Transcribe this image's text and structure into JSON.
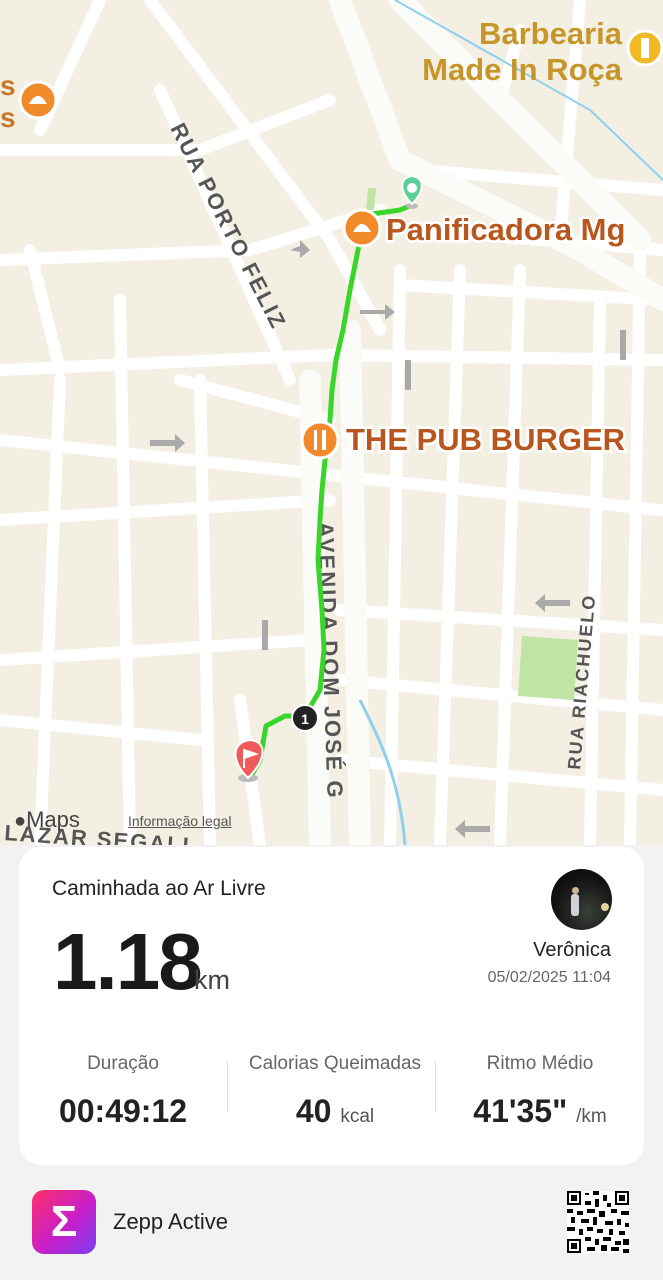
{
  "map": {
    "poi": {
      "barbearia": "Barbearia\nMade In Roça",
      "panificadora": "Panificadora Mg",
      "pub_burger": "THE PUB BURGER"
    },
    "streets": {
      "porto_feliz": "RUA PORTO FELIZ",
      "dom_jose": "AVENIDA DOM JOSÉ G",
      "riachuelo": "RUA RIACHUELO",
      "lazar": "LAZAR SEGALL",
      "left_edge_label": "s\ns"
    },
    "route_marker_number": "1",
    "maps_label": "Maps",
    "legal_label": "Informação legal",
    "route_color": "#39d42a",
    "start_color": "#5ccf95",
    "end_color": "#ef5a5a"
  },
  "card": {
    "activity": "Caminhada ao Ar Livre",
    "distance": "1.18",
    "distance_unit": "km",
    "user": "Verônica",
    "datetime": "05/02/2025 11:04",
    "stats": [
      {
        "label": "Duração",
        "value": "00:49:12",
        "unit": ""
      },
      {
        "label": "Calorias Queimadas",
        "value": "40",
        "unit": "kcal"
      },
      {
        "label": "Ritmo Médio",
        "value": "41'35\"",
        "unit": "/km"
      }
    ]
  },
  "footer": {
    "app_name": "Zepp Active",
    "app_logo_glyph": "Σ"
  },
  "icons": [
    "apple-icon",
    "route-start-pin-icon",
    "route-end-flag-icon",
    "restaurant-icon",
    "bakery-icon",
    "barber-icon",
    "qr-code-icon",
    "avatar-photo"
  ]
}
